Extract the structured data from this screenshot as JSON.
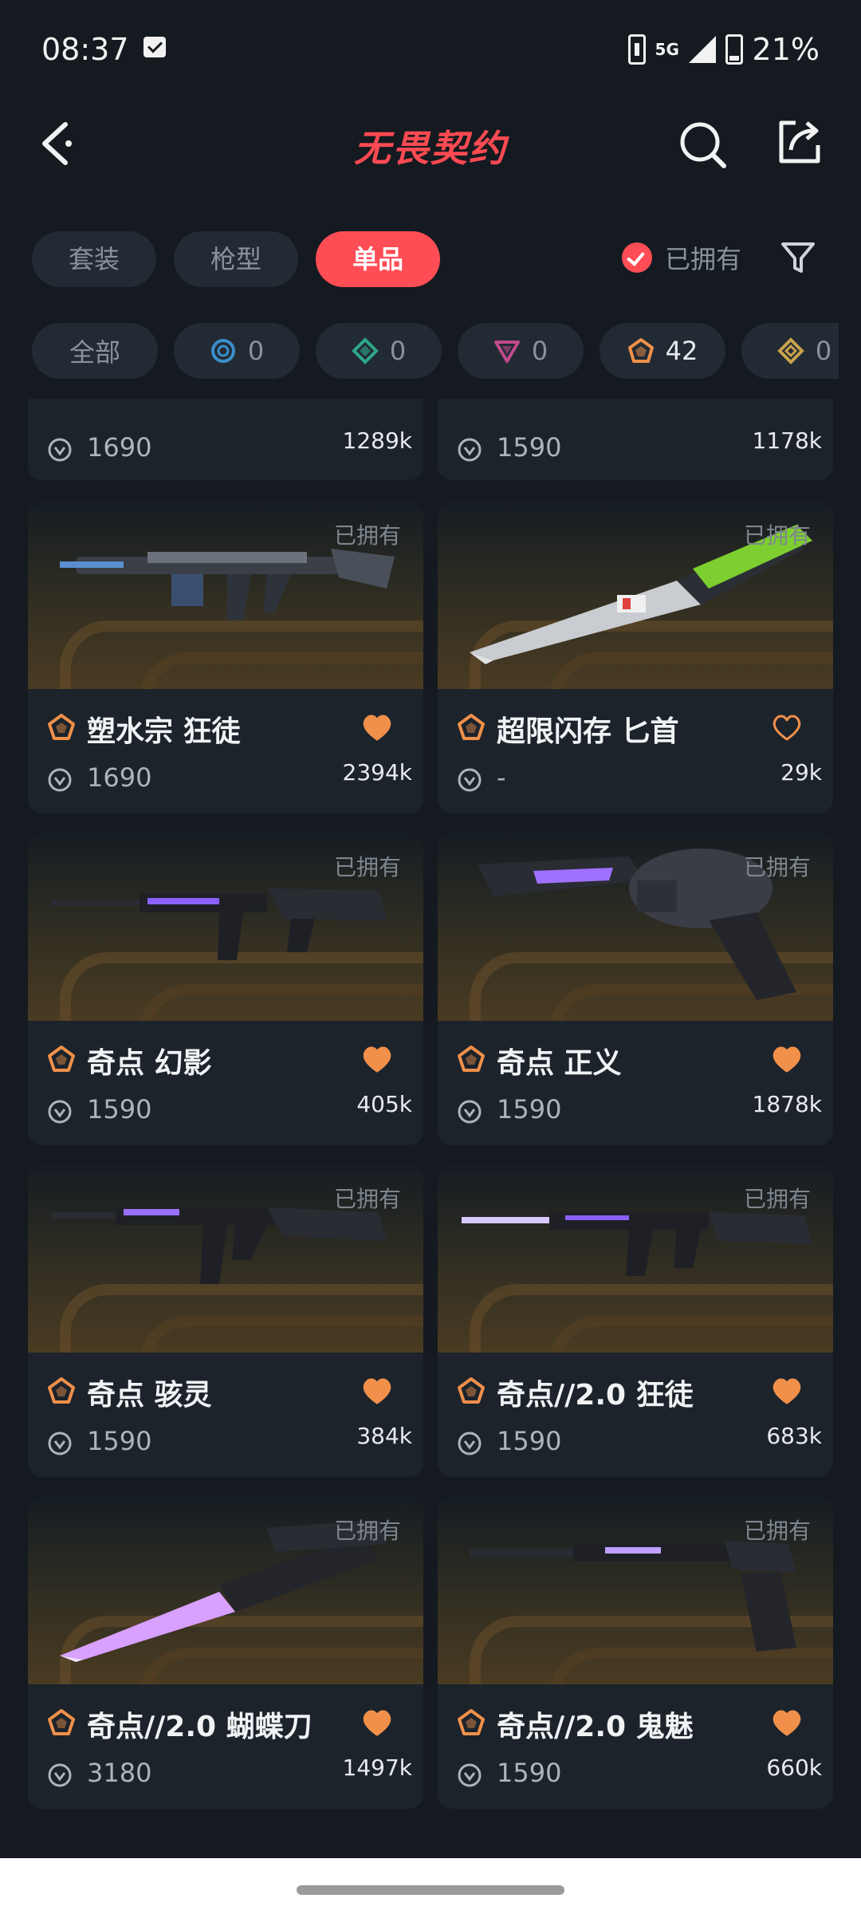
{
  "status_bar": {
    "time": "08:37",
    "network": "5G",
    "battery": "21%"
  },
  "header": {
    "title": "无畏契约"
  },
  "type_tabs": [
    {
      "label": "套装",
      "active": false
    },
    {
      "label": "枪型",
      "active": false
    },
    {
      "label": "单品",
      "active": true
    }
  ],
  "owned_filter": {
    "label": "已拥有",
    "checked": true
  },
  "tier_chips": [
    {
      "label": "全部",
      "icon": ""
    },
    {
      "label": "0",
      "icon": "select-tier",
      "color": "#3a8ec9"
    },
    {
      "label": "0",
      "icon": "deluxe-tier",
      "color": "#2fa88a"
    },
    {
      "label": "0",
      "icon": "premium-tier",
      "color": "#c04a8c"
    },
    {
      "label": "42",
      "icon": "exclusive-tier",
      "color": "#f0904a"
    },
    {
      "label": "0",
      "icon": "ultra-tier",
      "color": "#c9a24a"
    }
  ],
  "partial_row": [
    {
      "price": "1690",
      "likes": "1289k"
    },
    {
      "price": "1590",
      "likes": "1178k"
    }
  ],
  "items": [
    {
      "name": "塑水宗 狂徒",
      "price": "1690",
      "likes": "2394k",
      "owned": "已拥有",
      "favorited": true,
      "weapon": "rifle-blue"
    },
    {
      "name": "超限闪存 匕首",
      "price": "-",
      "likes": "29k",
      "owned": "已拥有",
      "favorited": false,
      "weapon": "knife-green"
    },
    {
      "name": "奇点 幻影",
      "price": "1590",
      "likes": "405k",
      "owned": "已拥有",
      "favorited": true,
      "weapon": "rifle-dark"
    },
    {
      "name": "奇点 正义",
      "price": "1590",
      "likes": "1878k",
      "owned": "已拥有",
      "favorited": true,
      "weapon": "revolver-dark"
    },
    {
      "name": "奇点 骇灵",
      "price": "1590",
      "likes": "384k",
      "owned": "已拥有",
      "favorited": true,
      "weapon": "smg-dark"
    },
    {
      "name": "奇点//2.0 狂徒",
      "price": "1590",
      "likes": "683k",
      "owned": "已拥有",
      "favorited": true,
      "weapon": "rifle-dark-2"
    },
    {
      "name": "奇点//2.0 蝴蝶刀",
      "price": "3180",
      "likes": "1497k",
      "owned": "已拥有",
      "favorited": true,
      "weapon": "knife-purple"
    },
    {
      "name": "奇点//2.0 鬼魅",
      "price": "1590",
      "likes": "660k",
      "owned": "已拥有",
      "favorited": true,
      "weapon": "pistol-dark"
    }
  ],
  "colors": {
    "accent": "#ff4d55",
    "heart": "#f0904a",
    "card_bg": "#1c232b",
    "page_bg": "#141a20"
  }
}
